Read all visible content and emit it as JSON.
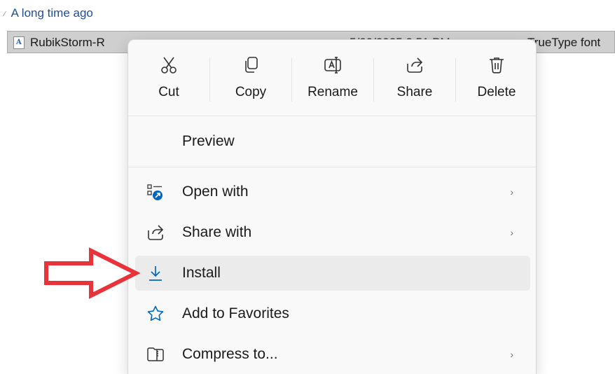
{
  "explorer": {
    "group_header": "A long time ago",
    "file": {
      "name": "RubikStorm-R",
      "date": "5/20/2025 2:51 PM",
      "type": "TrueType font"
    }
  },
  "context_menu": {
    "toolbar": [
      {
        "label": "Cut",
        "icon": "scissors-icon"
      },
      {
        "label": "Copy",
        "icon": "copy-icon"
      },
      {
        "label": "Rename",
        "icon": "rename-icon"
      },
      {
        "label": "Share",
        "icon": "share-icon"
      },
      {
        "label": "Delete",
        "icon": "trash-icon"
      }
    ],
    "items": [
      {
        "label": "Preview",
        "icon": "",
        "has_submenu": false
      },
      {
        "label": "Open with",
        "icon": "open-with-icon",
        "has_submenu": true
      },
      {
        "label": "Share with",
        "icon": "share-with-icon",
        "has_submenu": true
      },
      {
        "label": "Install",
        "icon": "download-icon",
        "has_submenu": false,
        "selected": true
      },
      {
        "label": "Add to Favorites",
        "icon": "star-icon",
        "has_submenu": false
      },
      {
        "label": "Compress to...",
        "icon": "zip-folder-icon",
        "has_submenu": true
      }
    ],
    "submenu_arrow": "›"
  },
  "colors": {
    "accent_blue": "#0067c0",
    "annotation_red": "#e8333a",
    "selected_bg": "#ebebeb"
  }
}
